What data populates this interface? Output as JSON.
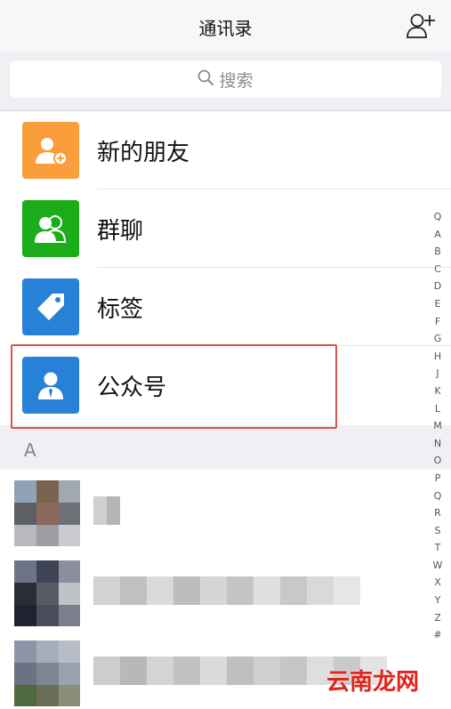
{
  "header": {
    "title": "通讯录"
  },
  "search": {
    "placeholder": "搜索"
  },
  "menu": [
    {
      "label": "新的朋友",
      "icon": "add-friend-icon",
      "color": "#fa9d3b"
    },
    {
      "label": "群聊",
      "icon": "group-chat-icon",
      "color": "#1aad19"
    },
    {
      "label": "标签",
      "icon": "tag-icon",
      "color": "#2782d7"
    },
    {
      "label": "公众号",
      "icon": "official-account-icon",
      "color": "#2782d7"
    }
  ],
  "section": {
    "letter": "A"
  },
  "index": [
    "Q",
    "A",
    "B",
    "C",
    "D",
    "E",
    "F",
    "G",
    "H",
    "J",
    "K",
    "L",
    "M",
    "N",
    "O",
    "P",
    "Q",
    "R",
    "S",
    "T",
    "W",
    "X",
    "Y",
    "Z",
    "#"
  ],
  "watermark": "云南龙网",
  "colors": {
    "highlight": "#d9534f",
    "brand_green": "#1aad19"
  }
}
